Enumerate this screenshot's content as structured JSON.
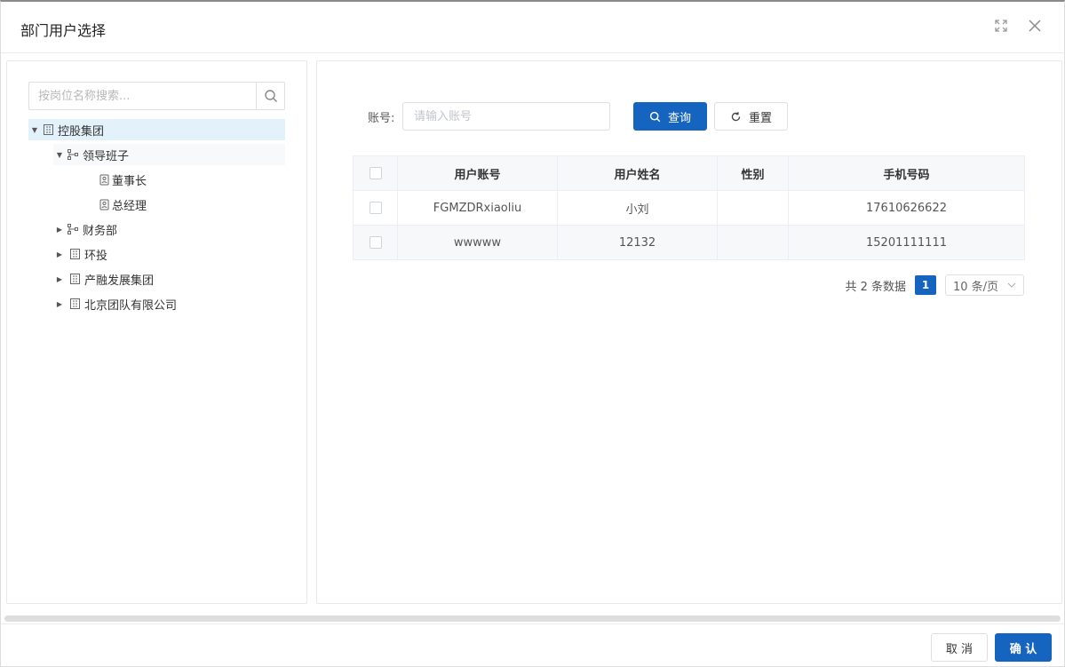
{
  "dialog": {
    "title": "部门用户选择"
  },
  "tree": {
    "search_placeholder": "按岗位名称搜索...",
    "nodes": [
      {
        "label": "控股集团",
        "icon": "building-icon",
        "expanded": true,
        "selected": true
      },
      {
        "label": "领导班子",
        "icon": "org-branch-icon",
        "expanded": true
      },
      {
        "label": "董事长",
        "icon": "position-icon"
      },
      {
        "label": "总经理",
        "icon": "position-icon"
      },
      {
        "label": "财务部",
        "icon": "org-branch-icon",
        "expanded": false
      },
      {
        "label": "环投",
        "icon": "building-icon",
        "expanded": false
      },
      {
        "label": "产融发展集团",
        "icon": "building-icon",
        "expanded": false
      },
      {
        "label": "北京团队有限公司",
        "icon": "building-icon",
        "expanded": false
      }
    ]
  },
  "filter": {
    "account_label": "账号:",
    "account_placeholder": "请输入账号",
    "search_label": "查询",
    "reset_label": "重置"
  },
  "table": {
    "columns": [
      "用户账号",
      "用户姓名",
      "性别",
      "手机号码"
    ],
    "rows": [
      {
        "account": "FGMZDRxiaoliu",
        "name": "小刘",
        "gender": "",
        "phone": "17610626622"
      },
      {
        "account": "wwwww",
        "name": "12132",
        "gender": "",
        "phone": "15201111111"
      }
    ]
  },
  "pagination": {
    "total_text": "共 2 条数据",
    "current_page": "1",
    "page_size": "10 条/页"
  },
  "footer": {
    "cancel_label": "取 消",
    "confirm_label": "确 认"
  },
  "colors": {
    "primary": "#1565c0",
    "selected_bg": "#e3f1fb"
  }
}
